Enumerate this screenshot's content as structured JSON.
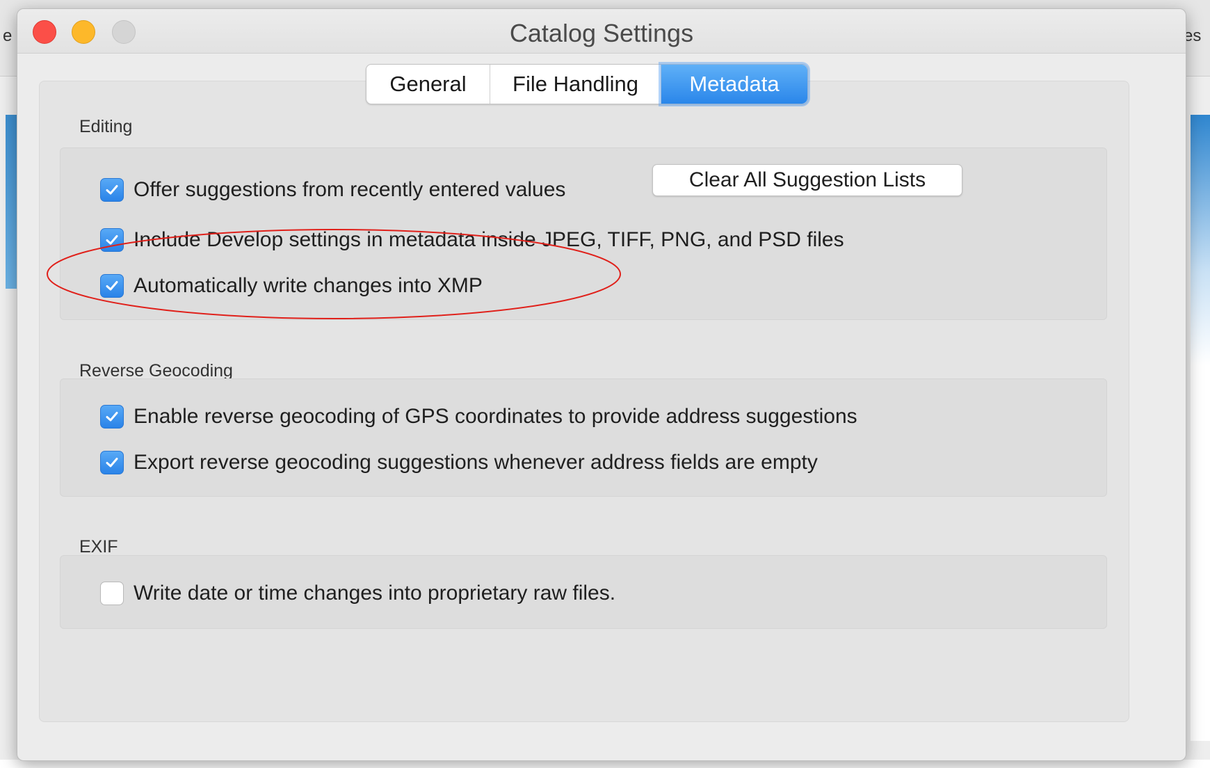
{
  "background": {
    "left_fragment": "e",
    "right_fragment": "es"
  },
  "window": {
    "title": "Catalog Settings"
  },
  "tabs": [
    {
      "label": "General",
      "selected": false
    },
    {
      "label": "File Handling",
      "selected": false
    },
    {
      "label": "Metadata",
      "selected": true
    }
  ],
  "sections": {
    "editing": {
      "label": "Editing",
      "items": [
        {
          "label": "Offer suggestions from recently entered values",
          "checked": true
        },
        {
          "label": "Include Develop settings in metadata inside JPEG, TIFF, PNG, and PSD files",
          "checked": true
        },
        {
          "label": "Automatically write changes into XMP",
          "checked": true
        }
      ],
      "button_label": "Clear All Suggestion Lists"
    },
    "reverse_geocoding": {
      "label": "Reverse Geocoding",
      "items": [
        {
          "label": "Enable reverse geocoding of GPS coordinates to provide address suggestions",
          "checked": true
        },
        {
          "label": "Export reverse geocoding suggestions whenever address fields are empty",
          "checked": true
        }
      ]
    },
    "exif": {
      "label": "EXIF",
      "items": [
        {
          "label": "Write date or time changes into proprietary raw files.",
          "checked": false
        }
      ]
    }
  },
  "colors": {
    "accent": "#2a86ea",
    "annotation": "#e0201a",
    "close": "#fb4f48",
    "minimize": "#fdb82a"
  }
}
